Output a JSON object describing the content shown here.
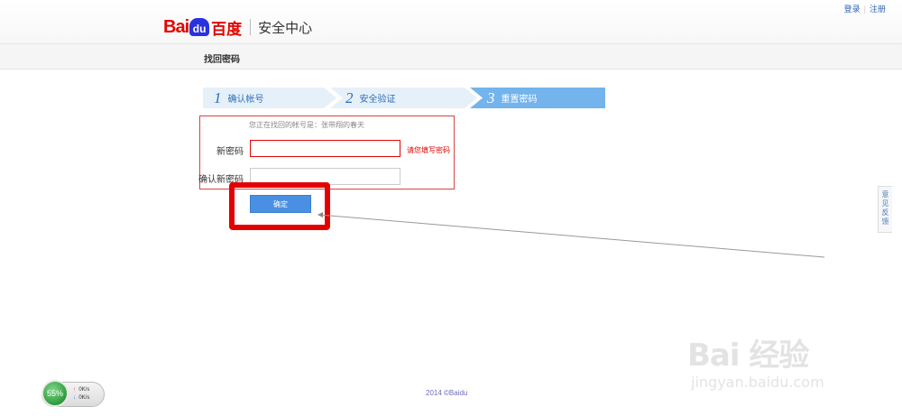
{
  "header": {
    "logo_bai": "Bai",
    "logo_du": "du",
    "logo_cn": "百度",
    "subtitle": "安全中心",
    "login_link": "登录",
    "register_link": "注册"
  },
  "subnav": {
    "title": "找回密码"
  },
  "steps": [
    {
      "number": "1",
      "label": "确认帐号",
      "state": "done"
    },
    {
      "number": "2",
      "label": "安全验证",
      "state": "done"
    },
    {
      "number": "3",
      "label": "重置密码",
      "state": "active"
    }
  ],
  "form": {
    "account_note": "您正在找回的帐号是：张带翔的春天",
    "new_password_label": "新密码",
    "new_password_value": "",
    "new_password_error": "请您填写密码",
    "confirm_password_label": "确认新密码",
    "confirm_password_value": "",
    "submit_label": "确定"
  },
  "feedback": {
    "label": "意见反馈"
  },
  "footer": {
    "copyright": "2014 ©Baidu"
  },
  "net_widget": {
    "percent": "55%",
    "up_speed": "0K/s",
    "down_speed": "0K/s"
  },
  "watermark": {
    "brand": "Bai  经验",
    "url": "jingyan.baidu.com"
  },
  "colors": {
    "brand_red": "#e10601",
    "brand_blue": "#2932e1",
    "step_active": "#73b4ec",
    "button": "#4a90e2",
    "highlight": "#e30000"
  }
}
